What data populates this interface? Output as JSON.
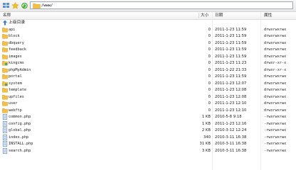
{
  "toolbar": {
    "buttons": [
      {
        "name": "grid-view-icon"
      },
      {
        "name": "favorite-star-icon"
      },
      {
        "name": "refresh-icon"
      }
    ],
    "address": "/www/"
  },
  "columns": {
    "name": "名称",
    "size": "大小",
    "date": "日期",
    "perm": "属性"
  },
  "up_dir": "上级目录",
  "colors": {
    "folder": "#f2c04a",
    "folder_dark": "#d9a12a",
    "file": "#3d6fb8",
    "special": "#4aa66a"
  },
  "files": [
    {
      "name": "api",
      "size": "0",
      "date": "2011-1-23 11:59",
      "perm": "drwxrwxrwx",
      "icon": "folder"
    },
    {
      "name": "block",
      "size": "0",
      "date": "2011-1-23 11:59",
      "perm": "drwxrwxrwx",
      "icon": "folder"
    },
    {
      "name": "dbquery",
      "size": "0",
      "date": "2011-1-23 11:59",
      "perm": "drwxrwxrwx",
      "icon": "folder"
    },
    {
      "name": "feedback",
      "size": "0",
      "date": "2011-1-23 11:59",
      "perm": "drwxrwxrwx",
      "icon": "folder"
    },
    {
      "name": "images",
      "size": "0",
      "date": "2011-1-23 11:59",
      "perm": "drwxrwxrwx",
      "icon": "folder"
    },
    {
      "name": "kingcms",
      "size": "0",
      "date": "2011-1-23 11:23",
      "perm": "drwxr-xr-x",
      "icon": "special"
    },
    {
      "name": "phpMyAdmin",
      "size": "0",
      "date": "2011-1-22 21:33",
      "perm": "drwxr-xr-x",
      "icon": "folder"
    },
    {
      "name": "portal",
      "size": "0",
      "date": "2011-1-23 11:59",
      "perm": "drwxrwxrwx",
      "icon": "folder"
    },
    {
      "name": "system",
      "size": "0",
      "date": "2011-1-23 12:07",
      "perm": "drwxrwxrwx",
      "icon": "special"
    },
    {
      "name": "template",
      "size": "0",
      "date": "2011-1-23 12:08",
      "perm": "drwxrwxrwx",
      "icon": "folder"
    },
    {
      "name": "upfiles",
      "size": "0",
      "date": "2011-1-23 12:08",
      "perm": "drwxrwxrwx",
      "icon": "folder"
    },
    {
      "name": "user",
      "size": "0",
      "date": "2011-1-23 12:10",
      "perm": "drwxrwxrwx",
      "icon": "folder"
    },
    {
      "name": "webftp",
      "size": "0",
      "date": "2011-1-23 12:10",
      "perm": "drwxrwxrwx",
      "icon": "folder"
    },
    {
      "name": "common.php",
      "size": "1 KB",
      "date": "2010-5-8 9:18",
      "perm": "-rwxrwxrwx",
      "icon": "file"
    },
    {
      "name": "config.php",
      "size": "1 KB",
      "date": "2011-1-23 12:16",
      "perm": "-rwxrwxrwx",
      "icon": "file"
    },
    {
      "name": "global.php",
      "size": "2 KB",
      "date": "2010-3-12 12:24",
      "perm": "-rwxrwxrwx",
      "icon": "file"
    },
    {
      "name": "index.php",
      "size": "340",
      "date": "2010-3-11 16:38",
      "perm": "-rwxrwxrwx",
      "icon": "file"
    },
    {
      "name": "INSTALL.php",
      "size": "31 KB",
      "date": "2010-3-11 16:38",
      "perm": "-rwxrwxrwx",
      "icon": "file"
    },
    {
      "name": "search.php",
      "size": "3 KB",
      "date": "2010-3-11 16:38",
      "perm": "-rwxrwxrwx",
      "icon": "file"
    }
  ]
}
